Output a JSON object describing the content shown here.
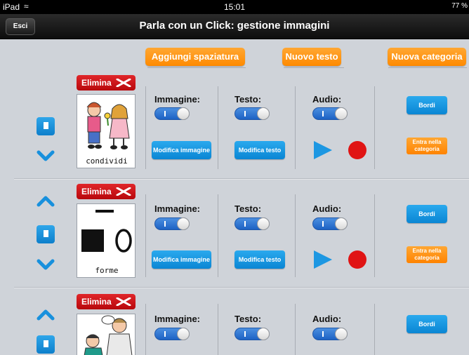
{
  "status": {
    "device": "iPad",
    "time": "15:01",
    "battery": "77 %"
  },
  "nav": {
    "back_label": "Esci",
    "title": "Parla con un Click: gestione immagini"
  },
  "toolbar": {
    "add_spacing": "Aggiungi spaziatura",
    "new_text": "Nuovo testo",
    "new_category": "Nuova categoria"
  },
  "labels": {
    "delete": "Elimina",
    "image": "Immagine:",
    "text": "Testo:",
    "audio": "Audio:",
    "edit_image": "Modifica immagine",
    "edit_text": "Modifica testo",
    "borders": "Bordi",
    "enter_category_line1": "Entra nella",
    "enter_category_line2": "categoria"
  },
  "items": [
    {
      "caption": "condividi"
    },
    {
      "caption": "forme"
    },
    {
      "caption": ""
    }
  ],
  "colors": {
    "accent_orange": "#ff8a00",
    "accent_blue": "#0d7fcb",
    "delete_red": "#c8101a",
    "record_red": "#e01414"
  }
}
